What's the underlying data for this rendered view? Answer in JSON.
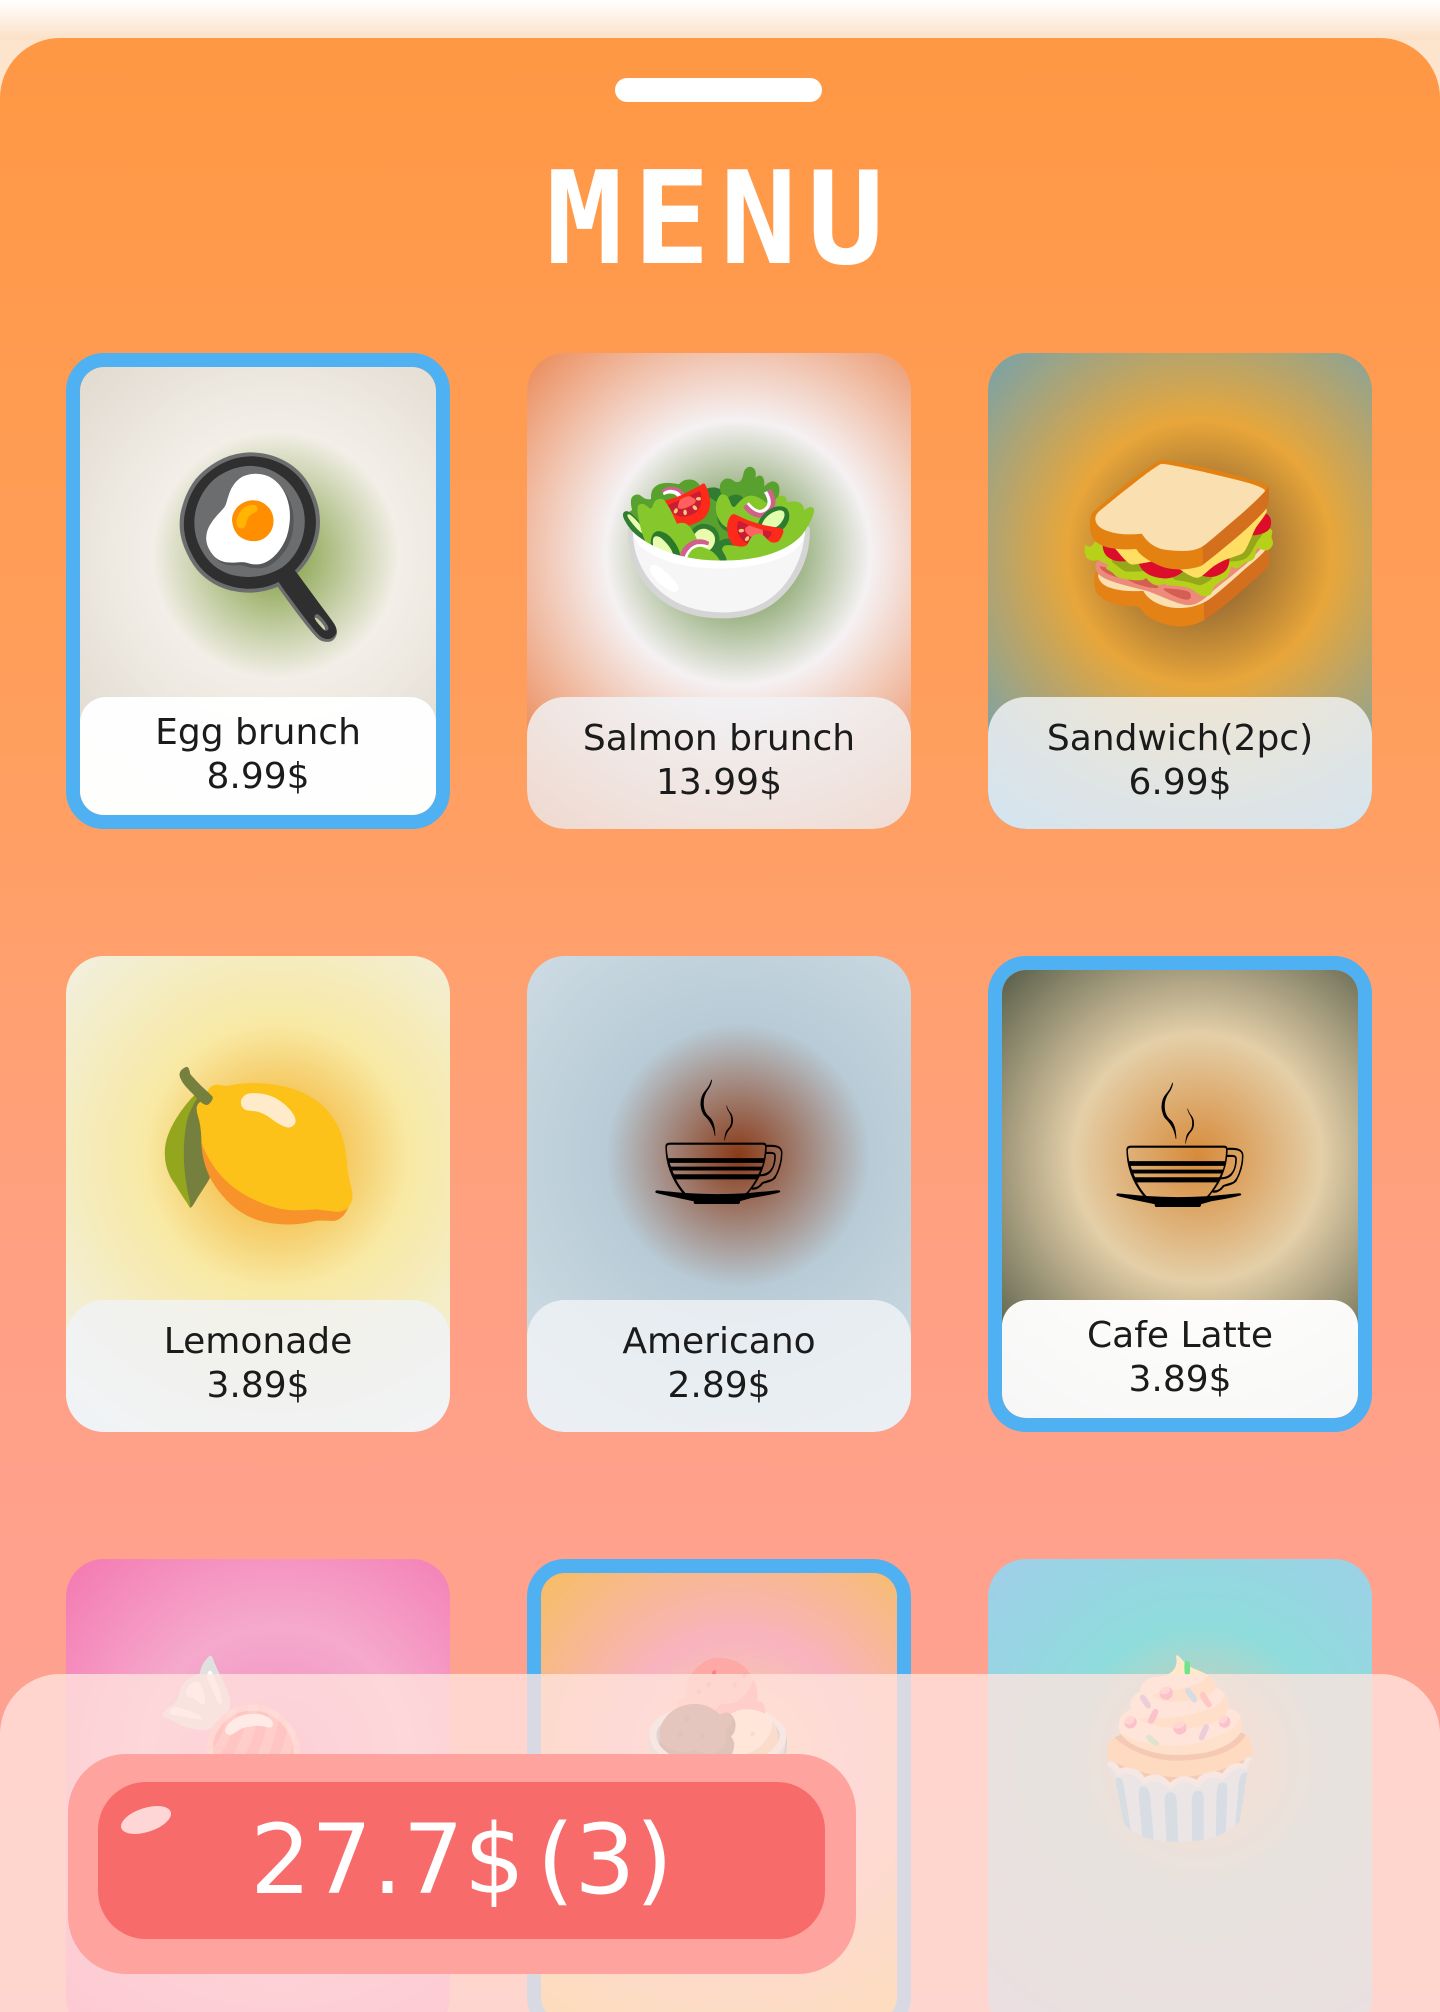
{
  "app": {
    "title": "MENU"
  },
  "menu_items": [
    {
      "name": "Egg brunch",
      "price": "8.99$",
      "selected": true,
      "icon": "egg-brunch-photo",
      "colors": [
        "#d9d2c6",
        "#f3efe8",
        "#7b9a3a"
      ]
    },
    {
      "name": "Salmon brunch",
      "price": "13.99$",
      "selected": false,
      "icon": "salmon-brunch-photo",
      "colors": [
        "#e8611a",
        "#f5f1f3",
        "#4f7f25"
      ]
    },
    {
      "name": "Sandwich(2pc)",
      "price": "6.99$",
      "selected": false,
      "icon": "sandwich-photo",
      "colors": [
        "#4ba1d6",
        "#e8a63a",
        "#6b4a2d"
      ]
    },
    {
      "name": "Lemonade",
      "price": "3.89$",
      "selected": false,
      "icon": "lemonade-photo",
      "colors": [
        "#eef2f8",
        "#f8e9a4",
        "#f2a81d"
      ]
    },
    {
      "name": "Americano",
      "price": "2.89$",
      "selected": false,
      "icon": "americano-photo",
      "colors": [
        "#d5e1e8",
        "#b8cbd6",
        "#8a3a17"
      ]
    },
    {
      "name": "Cafe Latte",
      "price": "3.89$",
      "selected": true,
      "icon": "latte-photo",
      "colors": [
        "#223326",
        "#e4cfa8",
        "#d78a3a"
      ]
    },
    {
      "name": "",
      "price": "",
      "selected": false,
      "icon": "macaron-photo",
      "colors": [
        "#f466a8",
        "#f5a9cc",
        "#f08cc0"
      ]
    },
    {
      "name": "",
      "price": "",
      "selected": true,
      "icon": "ice-cream-photo",
      "colors": [
        "#f6c23f",
        "#f8b3bf",
        "#f7d9a0"
      ]
    },
    {
      "name": "",
      "price": "",
      "selected": false,
      "icon": "cupcake-photo",
      "colors": [
        "#a6c9ee",
        "#8fdcdc",
        "#e6c9a7"
      ]
    }
  ],
  "cart": {
    "total": "27.7$",
    "count": "(3)"
  },
  "colors": {
    "selection_border": "#4fb0f2",
    "cart_button": "#f86b6b",
    "cart_outer": "#ffa39f",
    "sheet_top": "#ff9844",
    "sheet_bottom": "#ffa29a"
  }
}
